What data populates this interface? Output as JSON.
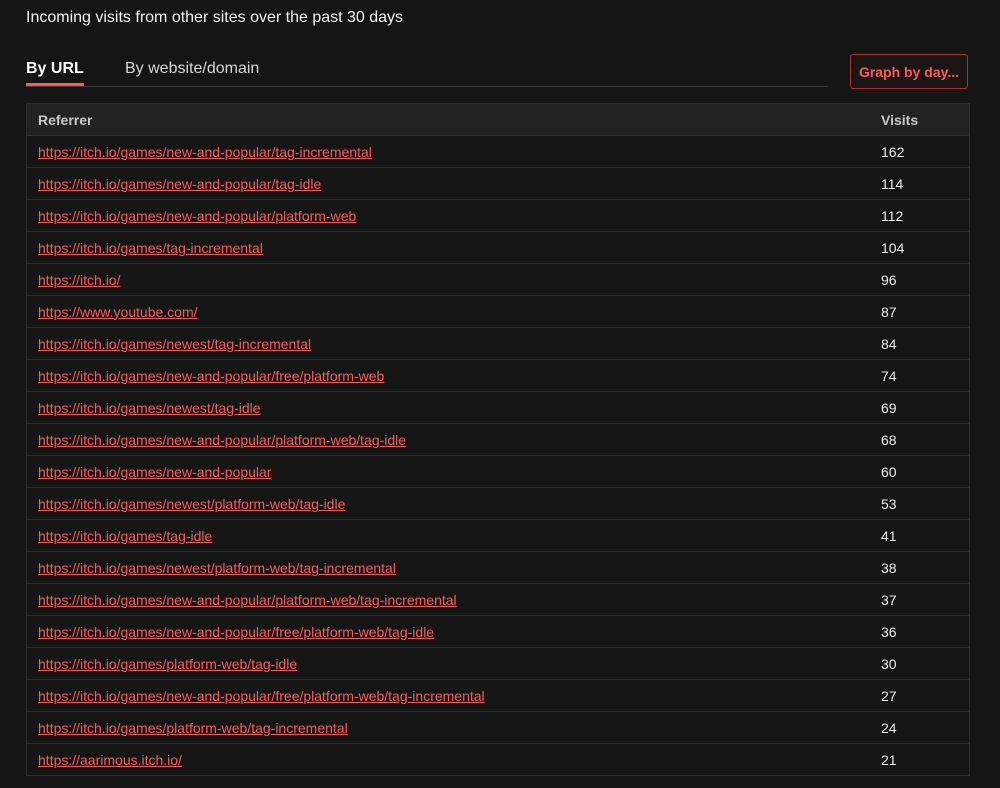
{
  "header": {
    "title": "Incoming visits from other sites over the past 30 days"
  },
  "tabs": [
    {
      "label": "By URL",
      "active": true
    },
    {
      "label": "By website/domain",
      "active": false
    }
  ],
  "toolbar": {
    "graph_label": "Graph by day..."
  },
  "colors": {
    "accent": "#fa5c5c",
    "background": "#151515"
  },
  "table": {
    "headers": {
      "referrer": "Referrer",
      "visits": "Visits"
    },
    "rows": [
      {
        "url": "https://itch.io/games/new-and-popular/tag-incremental",
        "visits": "162"
      },
      {
        "url": "https://itch.io/games/new-and-popular/tag-idle",
        "visits": "114"
      },
      {
        "url": "https://itch.io/games/new-and-popular/platform-web",
        "visits": "112"
      },
      {
        "url": "https://itch.io/games/tag-incremental",
        "visits": "104"
      },
      {
        "url": "https://itch.io/",
        "visits": "96"
      },
      {
        "url": "https://www.youtube.com/",
        "visits": "87"
      },
      {
        "url": "https://itch.io/games/newest/tag-incremental",
        "visits": "84"
      },
      {
        "url": "https://itch.io/games/new-and-popular/free/platform-web",
        "visits": "74"
      },
      {
        "url": "https://itch.io/games/newest/tag-idle",
        "visits": "69"
      },
      {
        "url": "https://itch.io/games/new-and-popular/platform-web/tag-idle",
        "visits": "68"
      },
      {
        "url": "https://itch.io/games/new-and-popular",
        "visits": "60"
      },
      {
        "url": "https://itch.io/games/newest/platform-web/tag-idle",
        "visits": "53"
      },
      {
        "url": "https://itch.io/games/tag-idle",
        "visits": "41"
      },
      {
        "url": "https://itch.io/games/newest/platform-web/tag-incremental",
        "visits": "38"
      },
      {
        "url": "https://itch.io/games/new-and-popular/platform-web/tag-incremental",
        "visits": "37"
      },
      {
        "url": "https://itch.io/games/new-and-popular/free/platform-web/tag-idle",
        "visits": "36"
      },
      {
        "url": "https://itch.io/games/platform-web/tag-idle",
        "visits": "30"
      },
      {
        "url": "https://itch.io/games/new-and-popular/free/platform-web/tag-incremental",
        "visits": "27"
      },
      {
        "url": "https://itch.io/games/platform-web/tag-incremental",
        "visits": "24"
      },
      {
        "url": "https://aarimous.itch.io/",
        "visits": "21"
      }
    ]
  }
}
